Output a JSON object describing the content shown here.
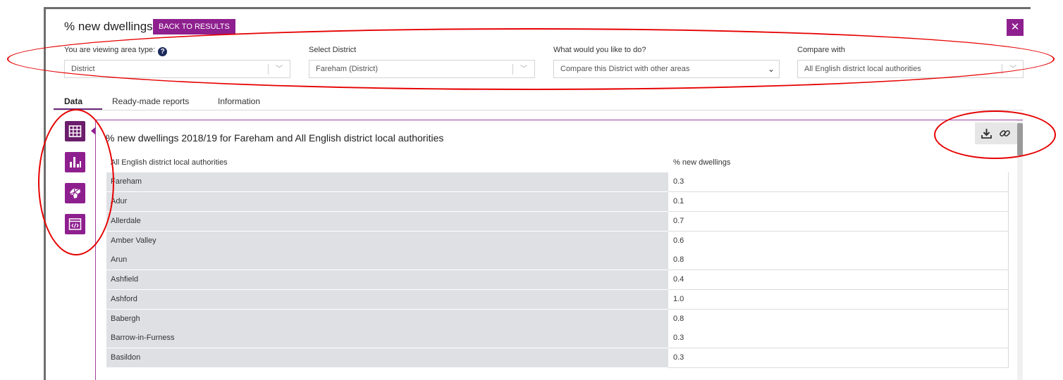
{
  "header": {
    "title": "% new dwellings",
    "back_label": "BACK TO RESULTS",
    "close_label": "✕"
  },
  "filters": {
    "area_type": {
      "label": "You are viewing area type:",
      "help": "?",
      "value": "District"
    },
    "district": {
      "label": "Select District",
      "value": "Fareham (District)"
    },
    "action": {
      "label": "What would you like to do?",
      "value": "Compare this District with other areas"
    },
    "compare": {
      "label": "Compare with",
      "value": "All English district local authorities"
    }
  },
  "tabs": [
    {
      "label": "Data",
      "active": true
    },
    {
      "label": "Ready-made reports",
      "active": false
    },
    {
      "label": "Information",
      "active": false
    }
  ],
  "sidebar": [
    {
      "icon": "table-icon",
      "active": true
    },
    {
      "icon": "bar-chart-icon",
      "active": false
    },
    {
      "icon": "map-icon",
      "active": false
    },
    {
      "icon": "embed-code-icon",
      "active": false
    }
  ],
  "panel": {
    "title": "% new dwellings 2018/19 for Fareham and All English district local authorities",
    "tools": [
      "download-icon",
      "link-icon"
    ]
  },
  "table": {
    "columns": [
      "All English district local authorities",
      "% new dwellings"
    ],
    "rows": [
      [
        "Fareham",
        "0.3"
      ],
      [
        "Adur",
        "0.1"
      ],
      [
        "Allerdale",
        "0.7"
      ],
      [
        "Amber Valley",
        "0.6"
      ],
      [
        "Arun",
        "0.8"
      ],
      [
        "Ashfield",
        "0.4"
      ],
      [
        "Ashford",
        "1.0"
      ],
      [
        "Babergh",
        "0.8"
      ],
      [
        "Barrow-in-Furness",
        "0.3"
      ],
      [
        "Basildon",
        "0.3"
      ]
    ]
  },
  "colors": {
    "accent": "#8e1f8e",
    "annotation": "#e60000",
    "row_shade": "#dfe0e4"
  }
}
